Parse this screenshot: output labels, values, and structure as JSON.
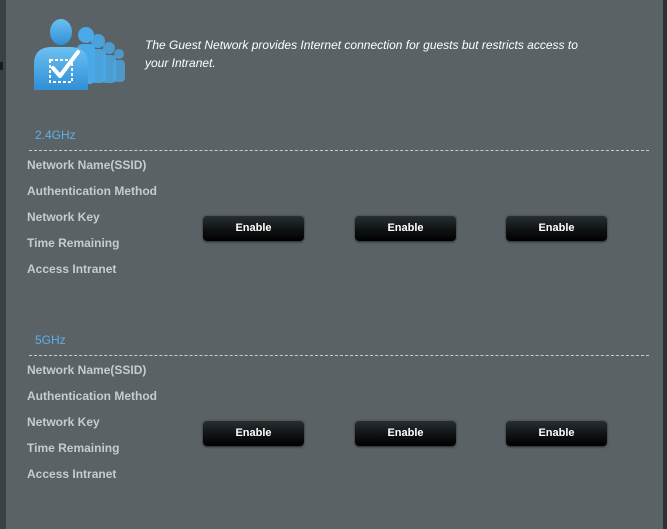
{
  "intro": {
    "line1": "The Guest Network provides Internet connection for guests but restricts access to",
    "line2": "your Intranet."
  },
  "bands": [
    {
      "title": "2.4GHz",
      "labels": [
        "Network Name(SSID)",
        "Authentication Method",
        "Network Key",
        "Time Remaining",
        "Access Intranet"
      ],
      "buttons": [
        "Enable",
        "Enable",
        "Enable"
      ]
    },
    {
      "title": "5GHz",
      "labels": [
        "Network Name(SSID)",
        "Authentication Method",
        "Network Key",
        "Time Remaining",
        "Access Intranet"
      ],
      "buttons": [
        "Enable",
        "Enable",
        "Enable"
      ]
    }
  ],
  "icons": {
    "header": "guest-users-check-icon"
  },
  "colors": {
    "background": "#5a6266",
    "section_title": "#5fb0e8",
    "label": "#c7cbcd",
    "icon": "#3fa2e3"
  }
}
